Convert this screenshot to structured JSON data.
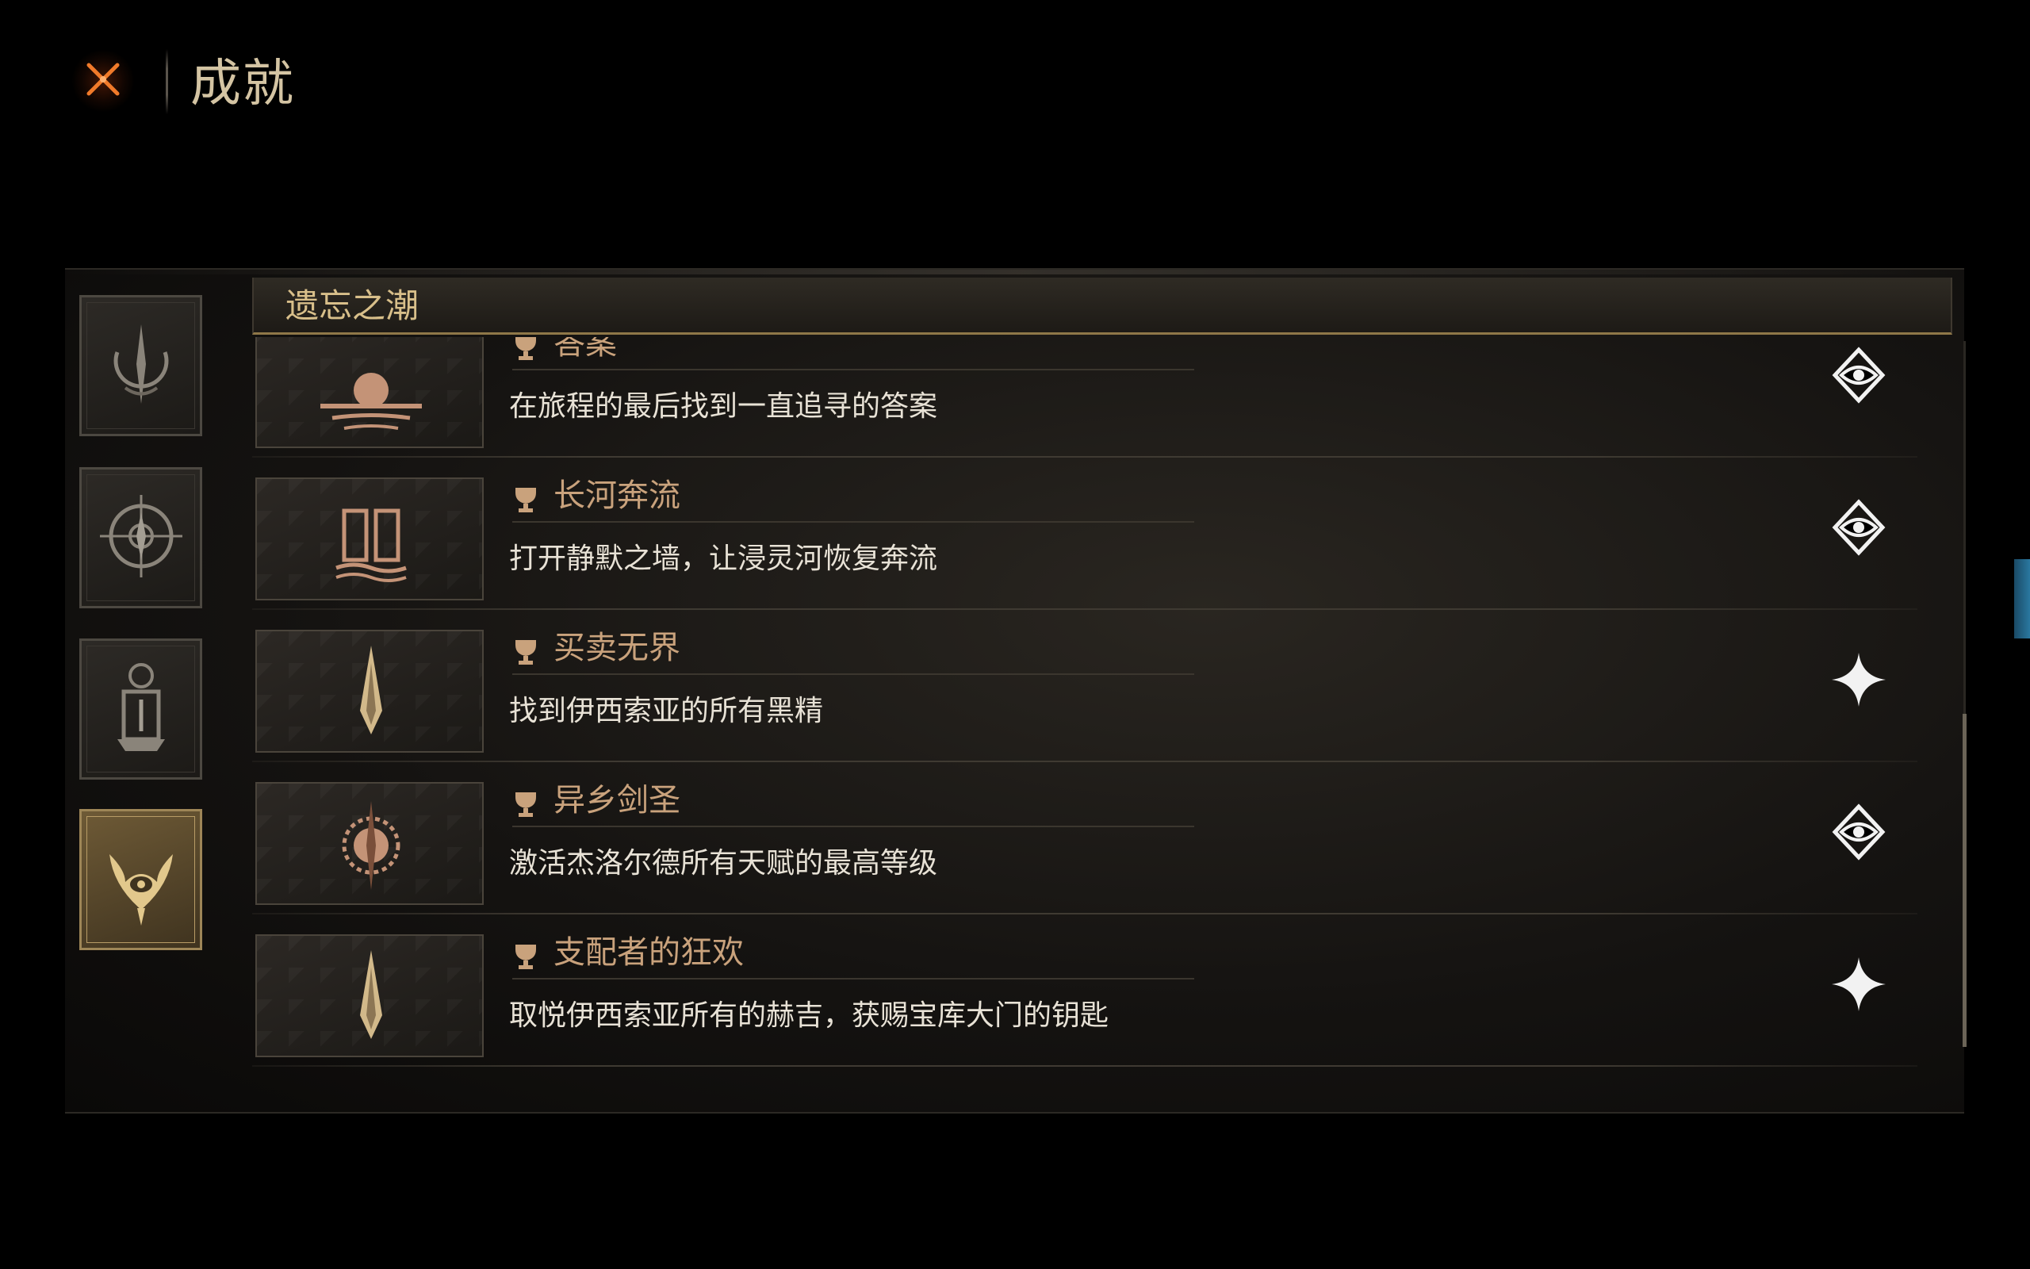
{
  "header": {
    "title": "成就",
    "close_icon": "close-x-icon"
  },
  "categories": [
    {
      "icon": "crescent-spire-icon",
      "active": false
    },
    {
      "icon": "compass-rune-icon",
      "active": false
    },
    {
      "icon": "lantern-shrine-icon",
      "active": false
    },
    {
      "icon": "horned-eye-icon",
      "active": true
    }
  ],
  "section": {
    "title": "遗忘之潮"
  },
  "achievements": [
    {
      "title": "答案",
      "description": "在旅程的最后找到一直追寻的答案",
      "emblem": "sunset-water-icon",
      "status": "unlocked-eye-icon"
    },
    {
      "title": "长河奔流",
      "description": "打开静默之墙，让浸灵河恢复奔流",
      "emblem": "river-gate-icon",
      "status": "unlocked-eye-icon"
    },
    {
      "title": "买卖无界",
      "description": "找到伊西索亚的所有黑精",
      "emblem": "arrowhead-icon",
      "status": "locked-star-icon"
    },
    {
      "title": "异乡剑圣",
      "description": "激活杰洛尔德所有天赋的最高等级",
      "emblem": "sword-sun-icon",
      "status": "unlocked-eye-icon"
    },
    {
      "title": "支配者的狂欢",
      "description": "取悦伊西索亚所有的赫吉，获赐宝库大门的钥匙",
      "emblem": "arrowhead-icon",
      "status": "locked-star-icon"
    }
  ],
  "colors": {
    "accent_gold": "#d8bf8a",
    "title_copper": "#c9a27c",
    "text_light": "#e8e2d6",
    "close_orange": "#f07a2a"
  }
}
